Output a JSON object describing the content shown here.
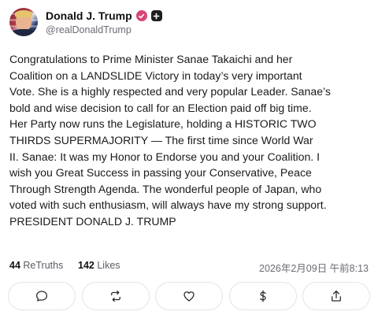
{
  "post": {
    "author": {
      "display_name": "Donald J. Trump",
      "handle": "@realDonaldTrump",
      "avatar_icon": "profile-photo",
      "verified_icon": "verified-check-icon",
      "verified_color": "#d6457a",
      "plus_icon": "plus-badge-icon"
    },
    "lines": [
      "Congratulations to Prime Minister Sanae Takaichi and her",
      "Coalition on a LANDSLIDE Victory in today’s very important",
      "Vote. She is a highly respected and very popular Leader. Sanae’s",
      "bold and wise decision to call for an Election paid off big time.",
      "Her Party now runs the Legislature, holding a HISTORIC TWO",
      "THIRDS SUPERMAJORITY — The first time since World War",
      "II. Sanae: It was my Honor to Endorse you and your Coalition. I",
      "wish you Great Success in passing your Conservative, Peace",
      "Through Strength Agenda. The wonderful people of Japan, who",
      "voted with such enthusiasm, will always have my strong support.",
      "PRESIDENT DONALD J. TRUMP"
    ],
    "stats": {
      "retruths_count": "44",
      "retruths_label": "ReTruths",
      "likes_count": "142",
      "likes_label": "Likes"
    },
    "timestamp": "2026年2月09日 午前8:13"
  },
  "actions": [
    {
      "name": "reply-button",
      "icon": "comment-icon"
    },
    {
      "name": "retruth-button",
      "icon": "repost-icon"
    },
    {
      "name": "like-button",
      "icon": "heart-icon"
    },
    {
      "name": "tip-button",
      "icon": "dollar-icon"
    },
    {
      "name": "share-button",
      "icon": "share-icon"
    }
  ],
  "colors": {
    "text": "#1a1a1a",
    "muted": "#6b6b76",
    "border": "#e4e4ea"
  }
}
